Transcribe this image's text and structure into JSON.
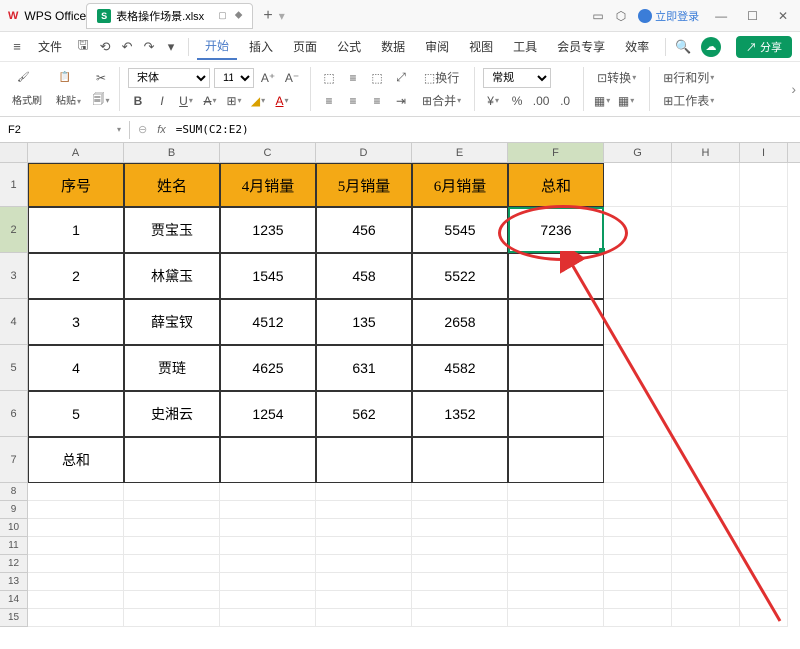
{
  "app": {
    "name": "WPS Office",
    "file_tab": "表格操作场景.xlsx",
    "login": "立即登录"
  },
  "menu": {
    "file": "文件",
    "tabs": [
      "开始",
      "插入",
      "页面",
      "公式",
      "数据",
      "审阅",
      "视图",
      "工具",
      "会员专享",
      "效率"
    ],
    "active": 0,
    "share": "分享"
  },
  "ribbon": {
    "format_painter": "格式刷",
    "paste": "粘贴",
    "font_name": "宋体",
    "font_size": "11",
    "wrap": "换行",
    "merge": "合并",
    "number_format": "常规",
    "convert": "转换",
    "rowcol": "行和列",
    "worksheet": "工作表"
  },
  "formula": {
    "cell_ref": "F2",
    "value": "=SUM(C2:E2)"
  },
  "cols": {
    "A": 96,
    "B": 96,
    "C": 96,
    "D": 96,
    "E": 96,
    "F": 96,
    "G": 68,
    "H": 68,
    "I": 48
  },
  "headers": [
    "序号",
    "姓名",
    "4月销量",
    "5月销量",
    "6月销量",
    "总和"
  ],
  "rows": [
    {
      "n": "1",
      "name": "贾宝玉",
      "c": "1235",
      "d": "456",
      "e": "5545",
      "f": "7236"
    },
    {
      "n": "2",
      "name": "林黛玉",
      "c": "1545",
      "d": "458",
      "e": "5522",
      "f": ""
    },
    {
      "n": "3",
      "name": "薛宝钗",
      "c": "4512",
      "d": "135",
      "e": "2658",
      "f": ""
    },
    {
      "n": "4",
      "name": "贾琏",
      "c": "4625",
      "d": "631",
      "e": "4582",
      "f": ""
    },
    {
      "n": "5",
      "name": "史湘云",
      "c": "1254",
      "d": "562",
      "e": "1352",
      "f": ""
    }
  ],
  "total_row_label": "总和"
}
